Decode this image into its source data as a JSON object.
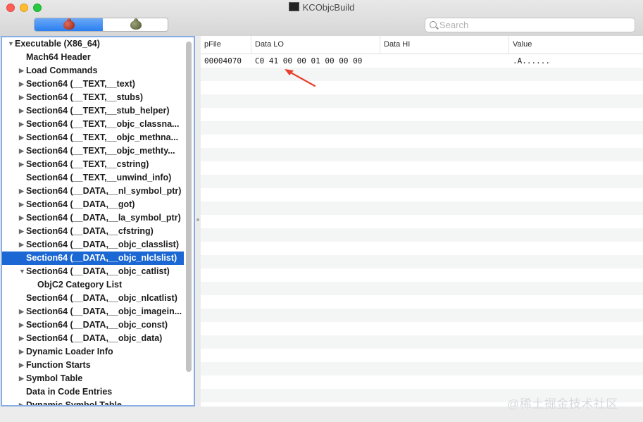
{
  "window": {
    "title": "KCObjcBuild"
  },
  "segmented": {
    "left_icon": "red-bug-icon",
    "right_icon": "green-bug-icon"
  },
  "search": {
    "placeholder": "Search",
    "value": ""
  },
  "tree": {
    "items": [
      {
        "label": "Executable  (X86_64)",
        "level": 0,
        "toggle": "expanded",
        "selected": false
      },
      {
        "label": "Mach64 Header",
        "level": 1,
        "toggle": "none",
        "selected": false
      },
      {
        "label": "Load Commands",
        "level": 1,
        "toggle": "collapsed",
        "selected": false
      },
      {
        "label": "Section64 (__TEXT,__text)",
        "level": 1,
        "toggle": "collapsed",
        "selected": false
      },
      {
        "label": "Section64 (__TEXT,__stubs)",
        "level": 1,
        "toggle": "collapsed",
        "selected": false
      },
      {
        "label": "Section64 (__TEXT,__stub_helper)",
        "level": 1,
        "toggle": "collapsed",
        "selected": false
      },
      {
        "label": "Section64 (__TEXT,__objc_classna...",
        "level": 1,
        "toggle": "collapsed",
        "selected": false
      },
      {
        "label": "Section64 (__TEXT,__objc_methna...",
        "level": 1,
        "toggle": "collapsed",
        "selected": false
      },
      {
        "label": "Section64 (__TEXT,__objc_methty...",
        "level": 1,
        "toggle": "collapsed",
        "selected": false
      },
      {
        "label": "Section64 (__TEXT,__cstring)",
        "level": 1,
        "toggle": "collapsed",
        "selected": false
      },
      {
        "label": "Section64 (__TEXT,__unwind_info)",
        "level": 1,
        "toggle": "none",
        "selected": false
      },
      {
        "label": "Section64 (__DATA,__nl_symbol_ptr)",
        "level": 1,
        "toggle": "collapsed",
        "selected": false
      },
      {
        "label": "Section64 (__DATA,__got)",
        "level": 1,
        "toggle": "collapsed",
        "selected": false
      },
      {
        "label": "Section64 (__DATA,__la_symbol_ptr)",
        "level": 1,
        "toggle": "collapsed",
        "selected": false
      },
      {
        "label": "Section64 (__DATA,__cfstring)",
        "level": 1,
        "toggle": "collapsed",
        "selected": false
      },
      {
        "label": "Section64 (__DATA,__objc_classlist)",
        "level": 1,
        "toggle": "collapsed",
        "selected": false
      },
      {
        "label": "Section64 (__DATA,__objc_nlclslist)",
        "level": 1,
        "toggle": "none",
        "selected": true
      },
      {
        "label": "Section64 (__DATA,__objc_catlist)",
        "level": 1,
        "toggle": "expanded",
        "selected": false
      },
      {
        "label": "ObjC2 Category List",
        "level": 2,
        "toggle": "none",
        "selected": false
      },
      {
        "label": "Section64 (__DATA,__objc_nlcatlist)",
        "level": 1,
        "toggle": "none",
        "selected": false
      },
      {
        "label": "Section64 (__DATA,__objc_imagein...",
        "level": 1,
        "toggle": "collapsed",
        "selected": false
      },
      {
        "label": "Section64 (__DATA,__objc_const)",
        "level": 1,
        "toggle": "collapsed",
        "selected": false
      },
      {
        "label": "Section64 (__DATA,__objc_data)",
        "level": 1,
        "toggle": "collapsed",
        "selected": false
      },
      {
        "label": "Dynamic Loader Info",
        "level": 1,
        "toggle": "collapsed",
        "selected": false
      },
      {
        "label": "Function Starts",
        "level": 1,
        "toggle": "collapsed",
        "selected": false
      },
      {
        "label": "Symbol Table",
        "level": 1,
        "toggle": "collapsed",
        "selected": false
      },
      {
        "label": "Data in Code Entries",
        "level": 1,
        "toggle": "none",
        "selected": false
      },
      {
        "label": "Dynamic Symbol Table",
        "level": 1,
        "toggle": "collapsed",
        "selected": false
      }
    ]
  },
  "table": {
    "columns": [
      "pFile",
      "Data LO",
      "Data HI",
      "Value"
    ],
    "rows": [
      {
        "pFile": "00004070",
        "data_lo": "C0 41 00 00 01 00 00 00",
        "data_hi": "",
        "value": ".A......"
      }
    ],
    "empty_row_count": 25
  },
  "colors": {
    "selection": "#1b67d3",
    "focus_ring": "#86aee4",
    "annotation_arrow": "#e8412e",
    "row_alternate": "#f4f5f5"
  },
  "watermark": {
    "text": "@稀土掘金技术社区"
  }
}
